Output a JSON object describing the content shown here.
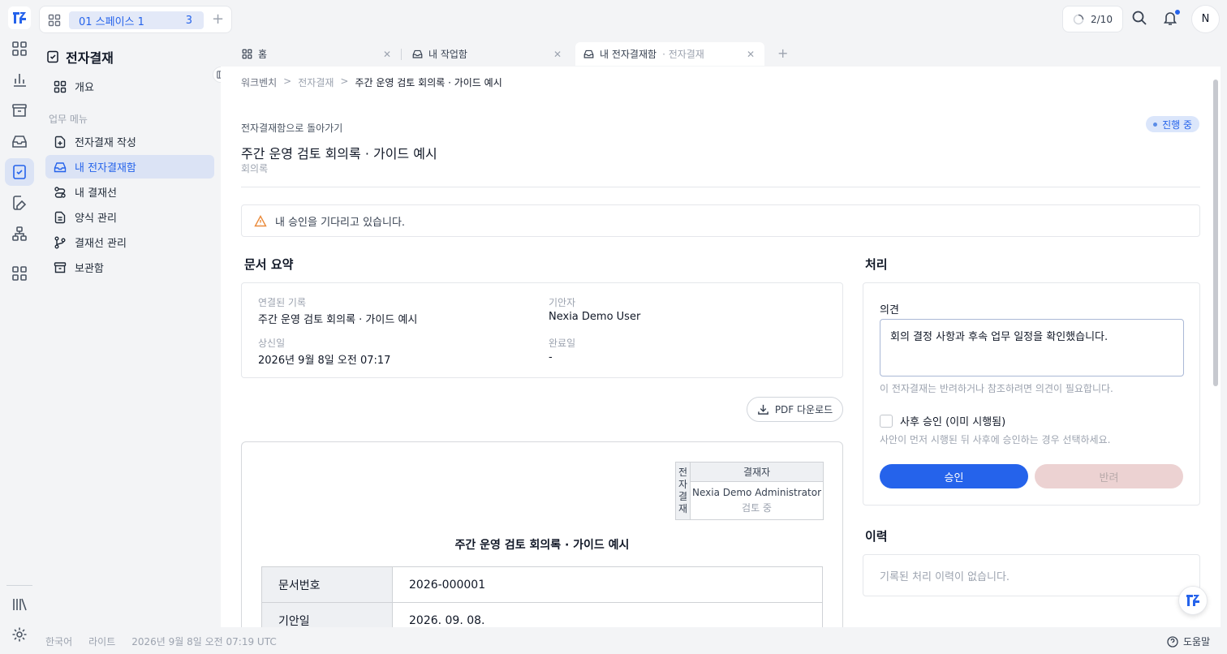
{
  "workspace": {
    "name": "01 스페이스 1",
    "count": "3"
  },
  "top": {
    "progress": "2/10"
  },
  "user": {
    "initial": "N"
  },
  "sidebar": {
    "title": "전자결재",
    "overview": "개요",
    "section": "업무 메뉴",
    "items": [
      {
        "label": "전자결재 작성"
      },
      {
        "label": "내 전자결재함"
      },
      {
        "label": "내 결재선"
      },
      {
        "label": "양식 관리"
      },
      {
        "label": "결재선 관리"
      },
      {
        "label": "보관함"
      }
    ]
  },
  "tabs": [
    {
      "label": "홈"
    },
    {
      "label": "내 작업함"
    },
    {
      "label": "내 전자결재함",
      "sub": "· 전자결재"
    }
  ],
  "breadcrumb": [
    "워크벤치",
    "전자결재",
    "주간 운영 검토 회의록 · 가이드 예시"
  ],
  "header": {
    "back": "전자결재함으로 돌아가기",
    "status": "진행 중",
    "title": "주간 운영 검토 회의록 · 가이드 예시",
    "type": "회의록"
  },
  "alert": "내 승인을 기다리고 있습니다.",
  "summary": {
    "title": "문서 요약",
    "linked_label": "연결된 기록",
    "linked_value": "주간 운영 검토 회의록 · 가이드 예시",
    "drafter_label": "기안자",
    "drafter_value": "Nexia Demo User",
    "submitted_label": "상신일",
    "submitted_value": "2026년 9월 8일 오전 07:17",
    "completed_label": "완료일",
    "completed_value": "-"
  },
  "pdf_button": "PDF 다운로드",
  "paper": {
    "approval_vertical": "전자결재",
    "approver_header": "결재자",
    "approver_name": "Nexia Demo Administrator",
    "approver_status": "검토 중",
    "title": "주간 운영 검토 회의록 · 가이드 예시",
    "rows": [
      {
        "key": "문서번호",
        "value": "2026-000001"
      },
      {
        "key": "기안일",
        "value": "2026. 09. 08."
      }
    ]
  },
  "process": {
    "title": "처리",
    "comment_label": "의견",
    "comment_value": "회의 결정 사항과 후속 업무 일정을 확인했습니다.",
    "comment_hint": "이 전자결재는 반려하거나 참조하려면 의견이 필요합니다.",
    "post_approval_label": "사후 승인 (이미 시행됨)",
    "post_approval_hint": "사안이 먼저 시행된 뒤 사후에 승인하는 경우 선택하세요.",
    "approve": "승인",
    "reject": "반려"
  },
  "history": {
    "title": "이력",
    "empty": "기록된 처리 이력이 없습니다."
  },
  "footer": {
    "language": "한국어",
    "theme": "라이트",
    "datetime": "2026년 9월 8일 오전 07:19 UTC",
    "help": "도움말"
  },
  "colors": {
    "accent": "#2563eb",
    "active_bg": "#dbe3f5",
    "warning": "#ea8a3a",
    "reject_bg": "#ecd2d2"
  }
}
